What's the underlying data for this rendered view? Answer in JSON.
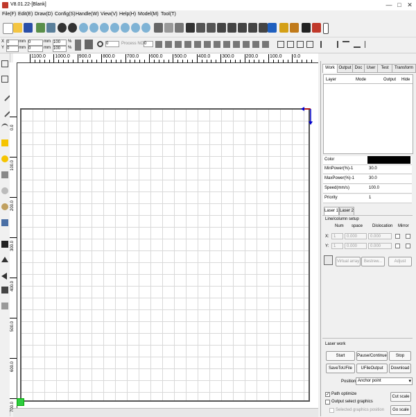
{
  "window": {
    "title": "V8.01.22-[Blank]",
    "minimize": "—",
    "maximize": "□",
    "close": "✕"
  },
  "menu": [
    "File(F)",
    "Edit(E)",
    "Draw(D)",
    "Config(S)",
    "Handle(W)",
    "View(V)",
    "Help(H)",
    "Model(M)",
    "Tool(T)"
  ],
  "toolbar2": {
    "x_label": "X",
    "y_label": "Y",
    "x_value": "0",
    "y_value": "0",
    "w_value": "0",
    "h_value": "0",
    "unit_mm": "mm",
    "unit_pct": "%",
    "pct_value_x": "100",
    "pct_value_y": "100",
    "rotate_value": "0",
    "process_no_label": "Process NO",
    "process_no_value": "0"
  },
  "ruler_top": [
    "1100.0",
    "1000.0",
    "900.0",
    "800.0",
    "700.0",
    "600.0",
    "500.0",
    "400.0",
    "300.0",
    "200.0",
    "100.0",
    "0.0"
  ],
  "ruler_left": [
    "0.0",
    "100.0",
    "200.0",
    "300.0",
    "400.0",
    "500.0",
    "600.0",
    "700.0",
    "800.0"
  ],
  "panel": {
    "tabs": [
      "Work",
      "Output",
      "Doc",
      "User",
      "Test",
      "Transform"
    ],
    "layer_headers": [
      "Layer",
      "Mode",
      "Output",
      "Hide"
    ],
    "props": [
      {
        "label": "Color",
        "value": ""
      },
      {
        "label": "MinPower(%)-1",
        "value": "30.0"
      },
      {
        "label": "MaxPower(%)-1",
        "value": "30.0"
      },
      {
        "label": "Speed(mm/s)",
        "value": "100.0"
      },
      {
        "label": "Priority",
        "value": "1"
      }
    ],
    "laser_tabs": [
      "Laser 1",
      "Laser 2"
    ],
    "array_title": "Line/column setup",
    "array_headers": [
      "Num",
      "space",
      "Dislocation",
      "Mirror"
    ],
    "array_x": {
      "label": "X:",
      "num": "1",
      "space": "0.000",
      "dislocation": "0.000"
    },
    "array_y": {
      "label": "Y:",
      "num": "1",
      "space": "0.000",
      "dislocation": "0.000"
    },
    "virtual_array": "Virtual array",
    "bestrew": "Bestrew...",
    "adjust": "Adjust",
    "laser_work_title": "Laser work",
    "buttons_row1": [
      "Start",
      "Pause/Continue",
      "Stop"
    ],
    "buttons_row2": [
      "SaveToUFile",
      "UFileOutput",
      "Download"
    ],
    "position_label": "Position",
    "position_value": "Anchor point",
    "path_optimize": "Path optimize",
    "output_select": "Output select graphics",
    "selected_position": "Selected graphics position",
    "cut_scale": "Cut scale",
    "go_scale": "Go scale"
  },
  "colors": {
    "layer_color": "#000000",
    "origin_marker": "#2ecc40",
    "axis_arrow_red": "#cc0000",
    "axis_arrow_blue": "#0000cc"
  }
}
